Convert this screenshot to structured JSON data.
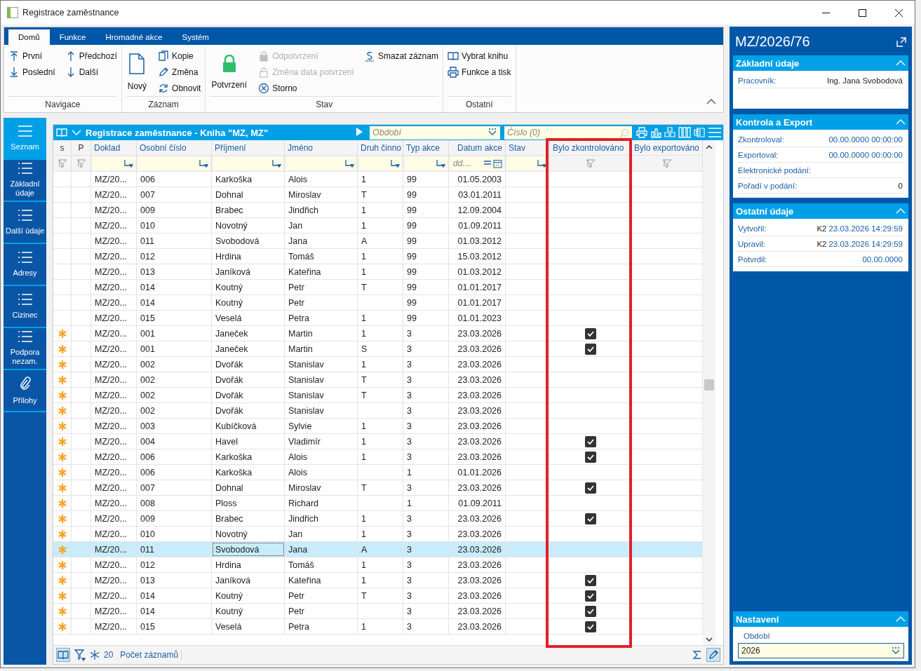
{
  "window": {
    "title": "Registrace zaměstnance"
  },
  "ribbon": {
    "tabs": [
      {
        "label": "Domů",
        "selected": true
      },
      {
        "label": "Funkce",
        "selected": false
      },
      {
        "label": "Hromadné akce",
        "selected": false
      },
      {
        "label": "Systém",
        "selected": false
      }
    ],
    "groups": [
      {
        "label": "Navigace",
        "items": [
          {
            "kind": "small",
            "label": "První"
          },
          {
            "kind": "small",
            "label": "Poslední"
          },
          {
            "kind": "small",
            "label": "Předchozí"
          },
          {
            "kind": "small",
            "label": "Další"
          }
        ]
      },
      {
        "label": "Záznam",
        "items": [
          {
            "kind": "big",
            "label": "Nový"
          },
          {
            "kind": "small",
            "label": "Kopie"
          },
          {
            "kind": "small",
            "label": "Změna"
          },
          {
            "kind": "small",
            "label": "Obnovit"
          }
        ]
      },
      {
        "label": "Stav",
        "items": [
          {
            "kind": "big",
            "label": "Potvrzení",
            "disabled": false
          },
          {
            "kind": "small",
            "label": "Odpotvrzení",
            "disabled": true
          },
          {
            "kind": "small",
            "label": "Změna data potvrzení",
            "disabled": true
          },
          {
            "kind": "small",
            "label": "Storno",
            "disabled": false
          },
          {
            "kind": "small",
            "label": "Smazat záznam",
            "disabled": false
          }
        ]
      },
      {
        "label": "Ostatní",
        "items": [
          {
            "kind": "small",
            "label": "Vybrat knihu"
          },
          {
            "kind": "small",
            "label": "Funkce a tisk"
          }
        ]
      }
    ]
  },
  "sidebar": {
    "items": [
      {
        "label": "Seznam",
        "selected": true
      },
      {
        "label": "Základní údaje",
        "selected": false
      },
      {
        "label": "Další údaje",
        "selected": false
      },
      {
        "label": "Adresy",
        "selected": false
      },
      {
        "label": "Cizinec",
        "selected": false
      },
      {
        "label": "Podpora nezam.",
        "selected": false
      },
      {
        "label": "Přílohy",
        "selected": false
      }
    ]
  },
  "grid": {
    "title": "Registrace zaměstnance - Kniha \"MZ, MZ\"",
    "period_field": {
      "placeholder": "Období"
    },
    "number_field": {
      "placeholder": "Číslo (0)"
    },
    "columns": [
      {
        "label": "s",
        "kind": "flag"
      },
      {
        "label": "P",
        "kind": "flag"
      },
      {
        "label": "Doklad",
        "kind": "text"
      },
      {
        "label": "Osobní číslo",
        "kind": "text"
      },
      {
        "label": "Příjmení",
        "kind": "text"
      },
      {
        "label": "Jméno",
        "kind": "text"
      },
      {
        "label": "Druh činno",
        "kind": "text"
      },
      {
        "label": "Typ akce",
        "kind": "text"
      },
      {
        "label": "Datum akce",
        "kind": "date",
        "placeholder": "dd...."
      },
      {
        "label": "Stav",
        "kind": "text"
      },
      {
        "label": "Bylo zkontrolováno",
        "kind": "flag",
        "highlighted": true
      },
      {
        "label": "Bylo exportováno",
        "kind": "flag",
        "highlighted": false
      }
    ],
    "rows": [
      {
        "new": false,
        "doklad": "MZ/20...",
        "osobni_cislo": "006",
        "prijmeni": "Karkoška",
        "jmeno": "Alois",
        "druh": "1",
        "typ": "99",
        "datum": "01.05.2003",
        "checked": false,
        "selected": false
      },
      {
        "new": false,
        "doklad": "MZ/20...",
        "osobni_cislo": "007",
        "prijmeni": "Dohnal",
        "jmeno": "Miroslav",
        "druh": "T",
        "typ": "99",
        "datum": "03.01.2011",
        "checked": false,
        "selected": false
      },
      {
        "new": false,
        "doklad": "MZ/20...",
        "osobni_cislo": "009",
        "prijmeni": "Brabec",
        "jmeno": "Jindřich",
        "druh": "1",
        "typ": "99",
        "datum": "12.09.2004",
        "checked": false,
        "selected": false
      },
      {
        "new": false,
        "doklad": "MZ/20...",
        "osobni_cislo": "010",
        "prijmeni": "Novotný",
        "jmeno": "Jan",
        "druh": "1",
        "typ": "99",
        "datum": "01.09.2011",
        "checked": false,
        "selected": false
      },
      {
        "new": false,
        "doklad": "MZ/20...",
        "osobni_cislo": "011",
        "prijmeni": "Svobodová",
        "jmeno": "Jana",
        "druh": "A",
        "typ": "99",
        "datum": "01.03.2012",
        "checked": false,
        "selected": false
      },
      {
        "new": false,
        "doklad": "MZ/20...",
        "osobni_cislo": "012",
        "prijmeni": "Hrdina",
        "jmeno": "Tomáš",
        "druh": "1",
        "typ": "99",
        "datum": "15.03.2012",
        "checked": false,
        "selected": false
      },
      {
        "new": false,
        "doklad": "MZ/20...",
        "osobni_cislo": "013",
        "prijmeni": "Janíková",
        "jmeno": "Kateřina",
        "druh": "1",
        "typ": "99",
        "datum": "01.03.2012",
        "checked": false,
        "selected": false
      },
      {
        "new": false,
        "doklad": "MZ/20...",
        "osobni_cislo": "014",
        "prijmeni": "Koutný",
        "jmeno": "Petr",
        "druh": "T",
        "typ": "99",
        "datum": "01.01.2017",
        "checked": false,
        "selected": false
      },
      {
        "new": false,
        "doklad": "MZ/20...",
        "osobni_cislo": "014",
        "prijmeni": "Koutný",
        "jmeno": "Petr",
        "typ": "99",
        "datum": "01.01.2017",
        "checked": false,
        "selected": false
      },
      {
        "new": false,
        "doklad": "MZ/20...",
        "osobni_cislo": "015",
        "prijmeni": "Veselá",
        "jmeno": "Petra",
        "druh": "1",
        "typ": "99",
        "datum": "01.01.2023",
        "checked": false,
        "selected": false
      },
      {
        "new": true,
        "doklad": "MZ/20...",
        "osobni_cislo": "001",
        "prijmeni": "Janeček",
        "jmeno": "Martin",
        "druh": "1",
        "typ": "3",
        "datum": "23.03.2026",
        "checked": true,
        "selected": false
      },
      {
        "new": true,
        "doklad": "MZ/20...",
        "osobni_cislo": "001",
        "prijmeni": "Janeček",
        "jmeno": "Martin",
        "druh": "S",
        "typ": "3",
        "datum": "23.03.2026",
        "checked": true,
        "selected": false
      },
      {
        "new": true,
        "doklad": "MZ/20...",
        "osobni_cislo": "002",
        "prijmeni": "Dvořák",
        "jmeno": "Stanislav",
        "druh": "1",
        "typ": "3",
        "datum": "23.03.2026",
        "checked": false,
        "selected": false
      },
      {
        "new": true,
        "doklad": "MZ/20...",
        "osobni_cislo": "002",
        "prijmeni": "Dvořák",
        "jmeno": "Stanislav",
        "druh": "T",
        "typ": "3",
        "datum": "23.03.2026",
        "checked": false,
        "selected": false
      },
      {
        "new": true,
        "doklad": "MZ/20...",
        "osobni_cislo": "002",
        "prijmeni": "Dvořák",
        "jmeno": "Stanislav",
        "druh": "T",
        "typ": "3",
        "datum": "23.03.2026",
        "checked": false,
        "selected": false
      },
      {
        "new": true,
        "doklad": "MZ/20...",
        "osobni_cislo": "002",
        "prijmeni": "Dvořák",
        "jmeno": "Stanislav",
        "typ": "3",
        "datum": "23.03.2026",
        "checked": false,
        "selected": false
      },
      {
        "new": true,
        "doklad": "MZ/20...",
        "osobni_cislo": "003",
        "prijmeni": "Kubíčková",
        "jmeno": "Sylvie",
        "druh": "1",
        "typ": "3",
        "datum": "23.03.2026",
        "checked": false,
        "selected": false
      },
      {
        "new": true,
        "doklad": "MZ/20...",
        "osobni_cislo": "004",
        "prijmeni": "Havel",
        "jmeno": "Vladimír",
        "druh": "1",
        "typ": "3",
        "datum": "23.03.2026",
        "checked": true,
        "selected": false
      },
      {
        "new": true,
        "doklad": "MZ/20...",
        "osobni_cislo": "006",
        "prijmeni": "Karkoška",
        "jmeno": "Alois",
        "druh": "1",
        "typ": "3",
        "datum": "23.03.2026",
        "checked": true,
        "selected": false
      },
      {
        "new": true,
        "doklad": "MZ/20...",
        "osobni_cislo": "006",
        "prijmeni": "Karkoška",
        "jmeno": "Alois",
        "typ": "1",
        "datum": "01.01.2026",
        "checked": false,
        "selected": false
      },
      {
        "new": true,
        "doklad": "MZ/20...",
        "osobni_cislo": "007",
        "prijmeni": "Dohnal",
        "jmeno": "Miroslav",
        "druh": "T",
        "typ": "3",
        "datum": "23.03.2026",
        "checked": true,
        "selected": false
      },
      {
        "new": true,
        "doklad": "MZ/20...",
        "osobni_cislo": "008",
        "prijmeni": "Ploss",
        "jmeno": "Richard",
        "typ": "1",
        "datum": "01.09.2011",
        "checked": false,
        "selected": false
      },
      {
        "new": true,
        "doklad": "MZ/20...",
        "osobni_cislo": "009",
        "prijmeni": "Brabec",
        "jmeno": "Jindřich",
        "druh": "1",
        "typ": "3",
        "datum": "23.03.2026",
        "checked": true,
        "selected": false
      },
      {
        "new": true,
        "doklad": "MZ/20...",
        "osobni_cislo": "010",
        "prijmeni": "Novotný",
        "jmeno": "Jan",
        "druh": "1",
        "typ": "3",
        "datum": "23.03.2026",
        "checked": false,
        "selected": false
      },
      {
        "new": true,
        "doklad": "MZ/20...",
        "osobni_cislo": "011",
        "prijmeni": "Svobodová",
        "jmeno": "Jana",
        "druh": "A",
        "typ": "3",
        "datum": "23.03.2026",
        "checked": false,
        "selected": true
      },
      {
        "new": true,
        "doklad": "MZ/20...",
        "osobni_cislo": "012",
        "prijmeni": "Hrdina",
        "jmeno": "Tomáš",
        "druh": "1",
        "typ": "3",
        "datum": "23.03.2026",
        "checked": false,
        "selected": false
      },
      {
        "new": true,
        "doklad": "MZ/20...",
        "osobni_cislo": "013",
        "prijmeni": "Janíková",
        "jmeno": "Kateřina",
        "druh": "1",
        "typ": "3",
        "datum": "23.03.2026",
        "checked": true,
        "selected": false
      },
      {
        "new": true,
        "doklad": "MZ/20...",
        "osobni_cislo": "014",
        "prijmeni": "Koutný",
        "jmeno": "Petr",
        "druh": "T",
        "typ": "3",
        "datum": "23.03.2026",
        "checked": true,
        "selected": false
      },
      {
        "new": true,
        "doklad": "MZ/20...",
        "osobni_cislo": "014",
        "prijmeni": "Koutný",
        "jmeno": "Petr",
        "typ": "3",
        "datum": "23.03.2026",
        "checked": true,
        "selected": false
      },
      {
        "new": true,
        "doklad": "MZ/20...",
        "osobni_cislo": "015",
        "prijmeni": "Veselá",
        "jmeno": "Petra",
        "druh": "1",
        "typ": "3",
        "datum": "23.03.2026",
        "checked": true,
        "selected": false
      }
    ],
    "footer": {
      "count": "20",
      "count_label": "Počet záznamů"
    }
  },
  "detail": {
    "title": "MZ/2026/76",
    "sections": [
      {
        "title": "Základní údaje",
        "fields": [
          {
            "label": "Pracovník:",
            "value": "Ing. Jana Svobodová"
          }
        ]
      },
      {
        "title": "Kontrola a Export",
        "fields": [
          {
            "label": "Zkontroloval:",
            "value": "00.00.0000 00:00:00"
          },
          {
            "label": "Exportoval:",
            "value": "00.00.0000 00:00:00"
          },
          {
            "label": "Elektronické podání:"
          },
          {
            "label": "Pořadí v podání:",
            "value": "0"
          }
        ]
      },
      {
        "title": "Ostatní údaje",
        "fields": [
          {
            "label": "Vytvořil:",
            "prefix": "K2",
            "value": "23.03.2026 14:29:59"
          },
          {
            "label": "Upravil:",
            "prefix": "K2",
            "value": "23.03.2026 14:29:59"
          },
          {
            "label": "Potvrdil:",
            "value": "00.00.0000"
          }
        ]
      }
    ],
    "settings": {
      "title": "Nastavení",
      "field_label": "Období",
      "field_value": "2026"
    }
  }
}
